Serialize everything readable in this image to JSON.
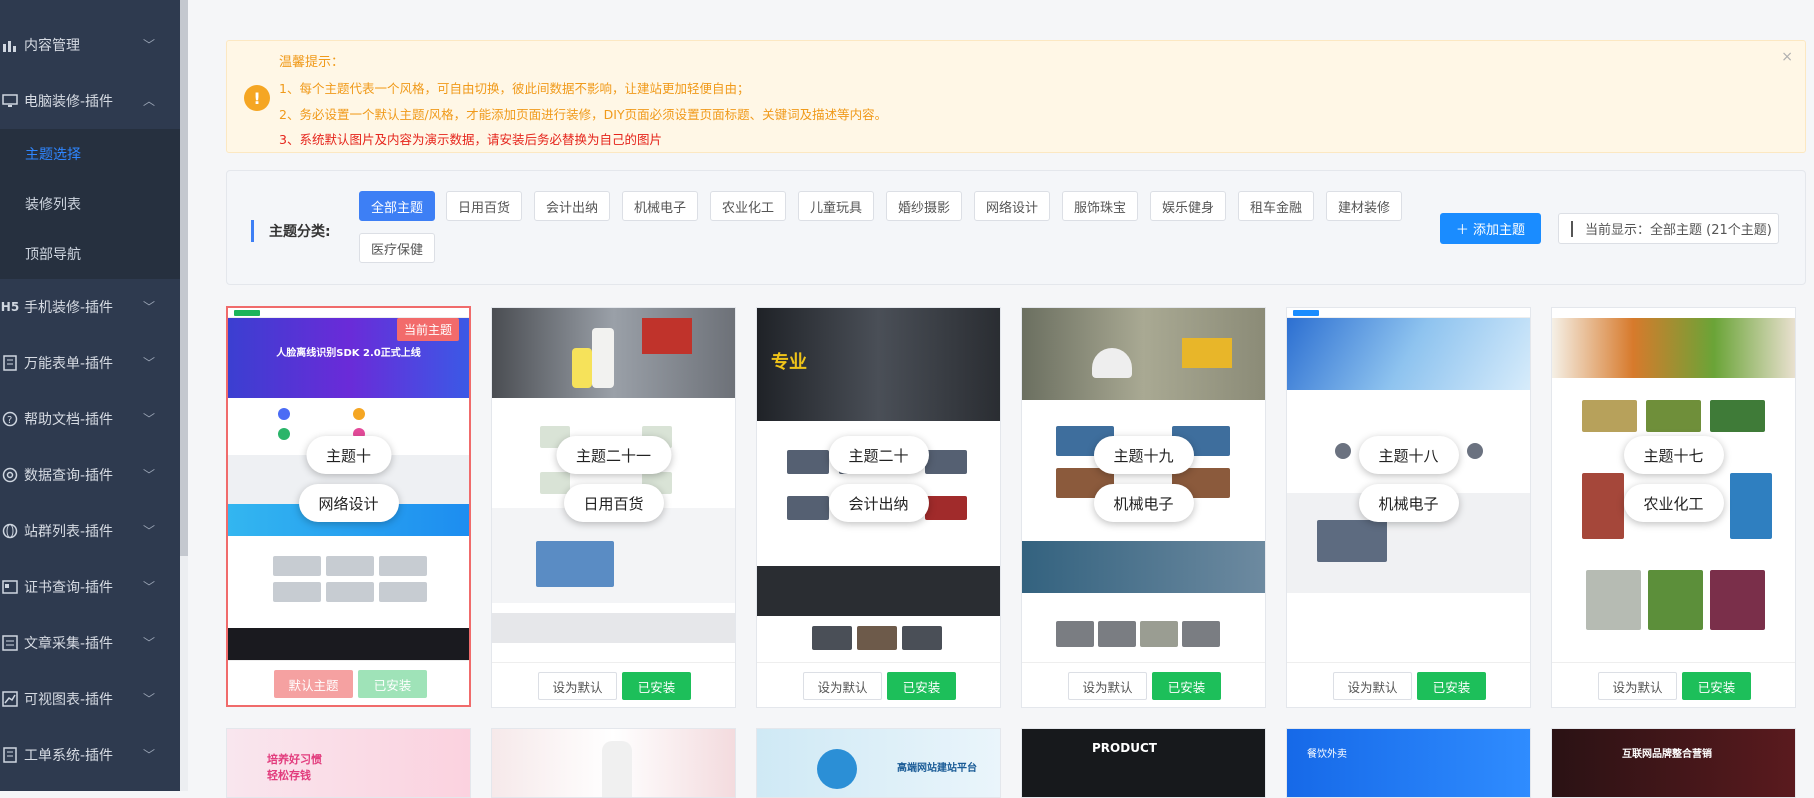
{
  "sidebar": {
    "items": [
      {
        "label": "内容管理",
        "icon": "bar-chart-icon"
      },
      {
        "label": "电脑装修-插件",
        "icon": "monitor-icon"
      },
      {
        "label": "手机装修-插件",
        "icon": "h5-icon"
      },
      {
        "label": "万能表单-插件",
        "icon": "form-icon"
      },
      {
        "label": "帮助文档-插件",
        "icon": "help-icon"
      },
      {
        "label": "数据查询-插件",
        "icon": "search-icon"
      },
      {
        "label": "站群列表-插件",
        "icon": "globe-icon"
      },
      {
        "label": "证书查询-插件",
        "icon": "certificate-icon"
      },
      {
        "label": "文章采集-插件",
        "icon": "article-icon"
      },
      {
        "label": "可视图表-插件",
        "icon": "line-chart-icon"
      },
      {
        "label": "工单系统-插件",
        "icon": "ticket-icon"
      }
    ],
    "sub_items": [
      "主题选择",
      "装修列表",
      "顶部导航"
    ],
    "active_sub": "主题选择"
  },
  "notice": {
    "title": "温馨提示：",
    "lines": [
      "1、每个主题代表一个风格，可自由切换，彼此间数据不影响，让建站更加轻便自由；",
      "2、务必设置一个默认主题/风格，才能添加页面进行装修，DIY页面必须设置页面标题、关键词及描述等内容。",
      "3、系统默认图片及内容为演示数据，请安装后务必替换为自己的图片"
    ],
    "close": "×",
    "warn_icon": "!"
  },
  "filter": {
    "label": "主题分类:",
    "chips": [
      "全部主题",
      "日用百货",
      "会计出纳",
      "机械电子",
      "农业化工",
      "儿童玩具",
      "婚纱摄影",
      "网络设计",
      "服饰珠宝",
      "娱乐健身",
      "租车金融",
      "建材装修",
      "医疗保健"
    ],
    "active": "全部主题",
    "add_button": "＋ 添加主题",
    "current": "当前显示：全部主题 (21个主题)"
  },
  "themes": [
    {
      "name": "主题十",
      "category": "网络设计",
      "badge": "当前主题",
      "banner_text": "人脸离线识别SDK 2.0正式上线",
      "default_label": "默认主题",
      "installed_label": "已安装"
    },
    {
      "name": "主题二十一",
      "category": "日用百货",
      "default_label": "设为默认",
      "installed_label": "已安装"
    },
    {
      "name": "主题二十",
      "category": "会计出纳",
      "banner_text": "专业",
      "default_label": "设为默认",
      "installed_label": "已安装"
    },
    {
      "name": "主题十九",
      "category": "机械电子",
      "default_label": "设为默认",
      "installed_label": "已安装"
    },
    {
      "name": "主题十八",
      "category": "机械电子",
      "default_label": "设为默认",
      "installed_label": "已安装"
    },
    {
      "name": "主题十七",
      "category": "农业化工",
      "default_label": "设为默认",
      "installed_label": "已安装"
    }
  ],
  "row2": [
    {
      "banner_text": "培养好习惯 轻松存钱"
    },
    {
      "banner_text": ""
    },
    {
      "banner_text": "高端网站建站平台"
    },
    {
      "banner_text": "PRODUCT"
    },
    {
      "banner_text": "餐饮外卖"
    },
    {
      "banner_text": "互联网品牌整合营销"
    }
  ],
  "colors": {
    "accent": "#3d7ff5",
    "install_green": "#1dbf5a",
    "sidebar_bg": "#2e3a4f",
    "selected_border": "#f06b6b"
  }
}
